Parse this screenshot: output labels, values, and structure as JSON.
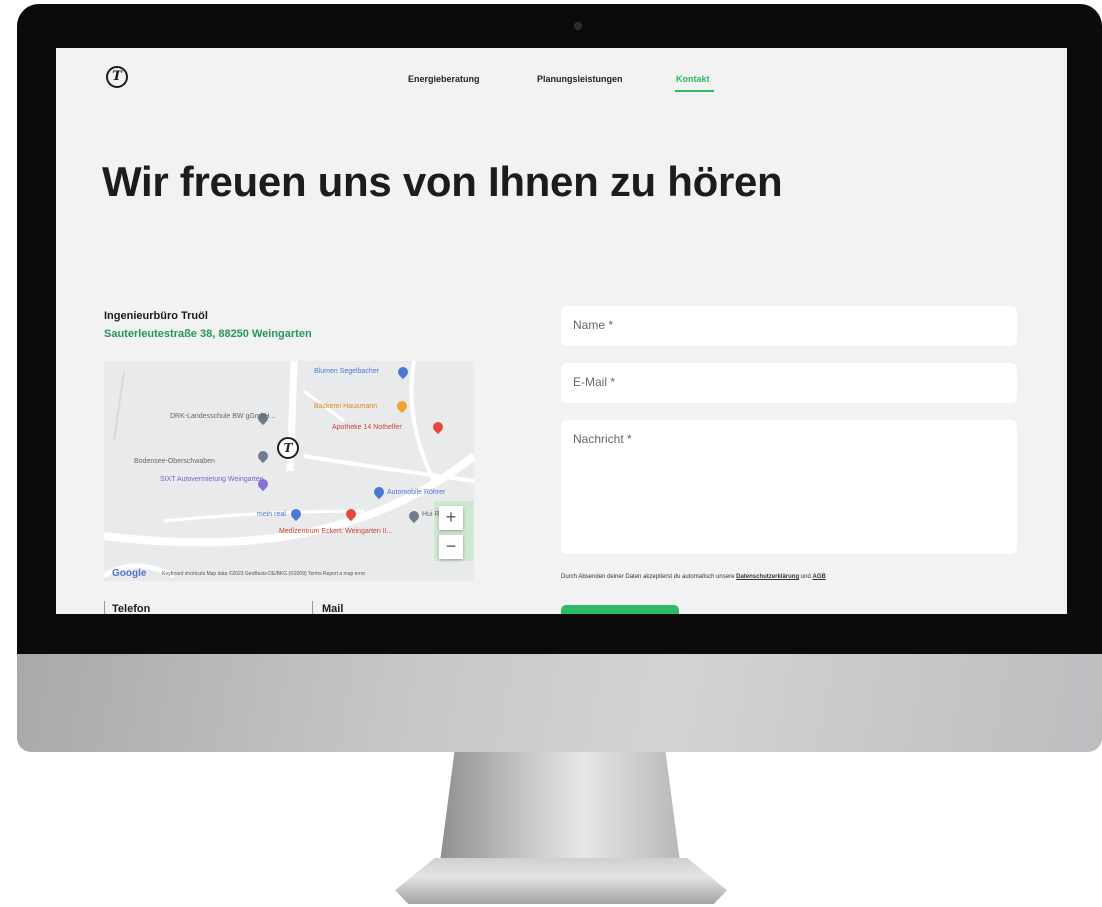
{
  "nav": {
    "items": [
      "Energieberatung",
      "Planungsleistungen",
      "Kontakt"
    ],
    "active": "Kontakt"
  },
  "headline": "Wir freuen uns von Ihnen zu hören",
  "company": {
    "name": "Ingenieurbüro Truöl",
    "address": "Sauterleutestraße 38, 88250 Weingarten"
  },
  "map": {
    "labels": {
      "blumen": "Blumen Segelbacher",
      "baeckerei": "Bäckerei Hausmann",
      "apotheke": "Apotheke 14 Nothelfer",
      "drk": "DRK-Landesschule BW gGmbH...",
      "bodensee": "Bodensee-Oberschwaben",
      "sixt": "SIXT Autovermietung Weingarten",
      "automobile": "Automobile Röhrer",
      "meinreal": "mein real",
      "medizentrum": "Medizentrum Eckert: Weingarten II...",
      "hui": "Hui Rav"
    },
    "zoom_in": "+",
    "zoom_out": "−",
    "google": "Google",
    "footer": "Keyboard shortcuts   Map data ©2023 GeoBasis-DE/BKG (©2009)   Terms   Report a map error"
  },
  "contact": {
    "phone_label": "Telefon",
    "mail_label": "Mail"
  },
  "form": {
    "name_placeholder": "Name *",
    "email_placeholder": "E-Mail *",
    "message_placeholder": "Nachricht *",
    "consent_text": "Durch Absenden deiner Daten akzeptierst du automatisch unsere",
    "privacy_link": "Datenschutzerklärung",
    "and": "und",
    "agb_link": "AGB"
  },
  "colors": {
    "accent": "#2bbb67",
    "page_bg": "#f2f2f2"
  }
}
